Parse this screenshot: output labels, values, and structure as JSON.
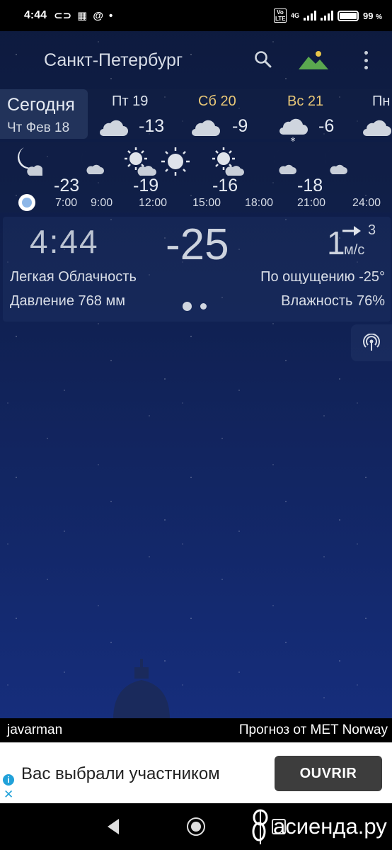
{
  "status_bar": {
    "time": "4:44",
    "battery_percent": "99",
    "percent_sign": "%",
    "network": "4G",
    "volte": "Vo LTE",
    "battery_level": 0.99,
    "icons": [
      "link-icon",
      "calendar-icon",
      "at-icon",
      "dot-icon",
      "signal-icon",
      "battery-icon"
    ]
  },
  "header": {
    "city": "Санкт-Петербург",
    "icons": [
      "search-icon",
      "mountain-icon",
      "more-vert-icon"
    ]
  },
  "days": {
    "today_title": "Сегодня",
    "today_date": "Чт Фев 18",
    "items": [
      {
        "name": "Пт 19",
        "temp": "-13",
        "color": "#dde3ec",
        "icon": "cloud-icon"
      },
      {
        "name": "Сб 20",
        "temp": "-9",
        "color": "#e8c777",
        "icon": "cloud-icon"
      },
      {
        "name": "Вс 21",
        "temp": "-6",
        "color": "#e8c777",
        "icon": "cloud-snow-icon"
      },
      {
        "name": "Пн",
        "temp": "",
        "color": "#dde3ec",
        "icon": "cloud-icon"
      }
    ]
  },
  "hourly": {
    "temps": [
      "-23",
      "-19",
      "-16",
      "-18"
    ],
    "times": [
      "7:00",
      "9:00",
      "12:00",
      "15:00",
      "18:00",
      "21:00",
      "24:00"
    ],
    "icons": [
      "moon-cloud-icon",
      "moon-cloud-icon",
      "sun-cloud-icon",
      "sun-icon",
      "sun-cloud-icon",
      "moon-cloud-icon",
      "moon-cloud-icon"
    ]
  },
  "current": {
    "time": "4:44",
    "temp": "-25",
    "wind_speed": "1",
    "wind_dir": "3",
    "wind_unit": "м/с",
    "condition": "Легкая Облачность",
    "feels_like": "По ощущению -25°",
    "pressure": "Давление 768 мм",
    "humidity": "Влажность 76%"
  },
  "footer": {
    "user": "javarman",
    "source": "Прогноз от MET Norway"
  },
  "ad": {
    "text": "Вас выбрали участником",
    "button": "OUVRIR",
    "info": "i",
    "close": "✕"
  },
  "watermark": "асиенда.ру",
  "colors": {
    "accent_gold": "#e8c777",
    "day_text": "#dde3ec",
    "bg_top": "#0d1a3d",
    "bg_bottom": "#18328a"
  }
}
